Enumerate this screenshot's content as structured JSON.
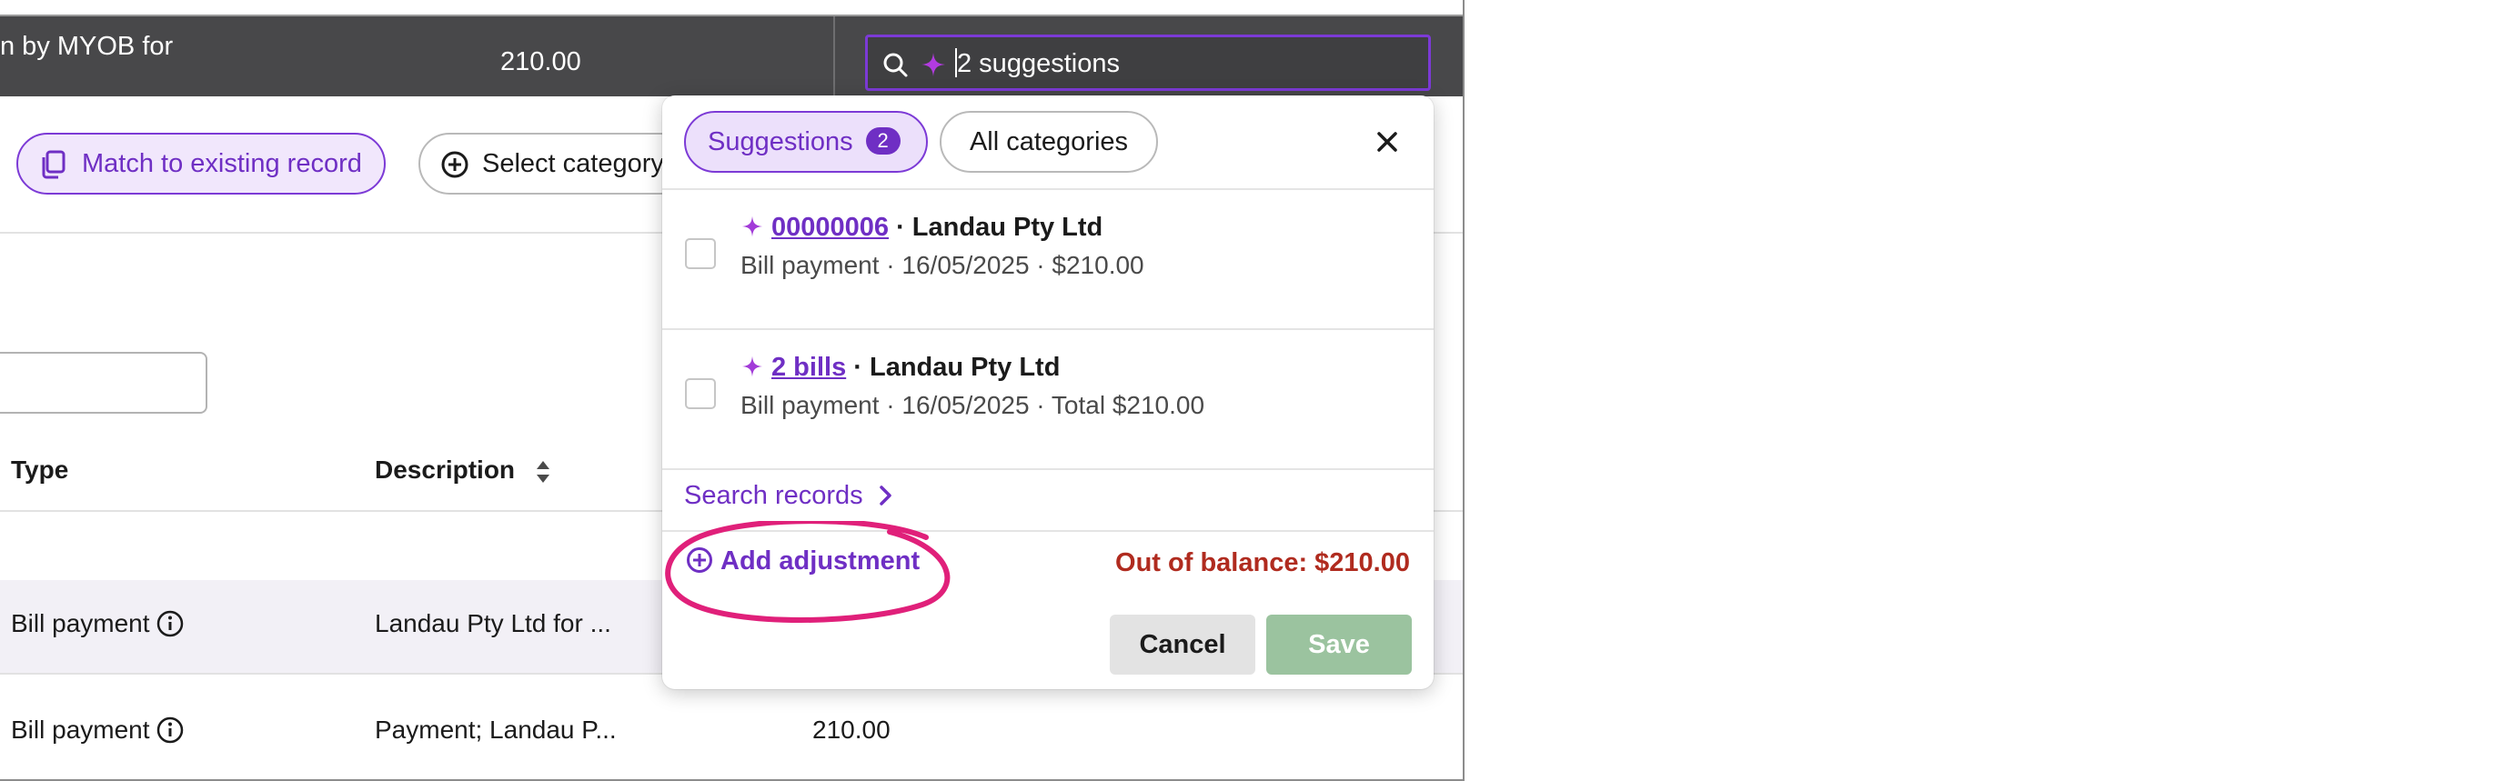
{
  "summary_bar": {
    "description": "n by MYOB for",
    "amount": "210.00",
    "search": {
      "value": "2 suggestions"
    }
  },
  "actions": {
    "match_label": "Match to existing record",
    "select_label": "Select category"
  },
  "table": {
    "headers": {
      "type": "Type",
      "description": "Description"
    },
    "rows": [
      {
        "type": "Bill payment",
        "description": "Landau Pty Ltd for ...",
        "amount": ""
      },
      {
        "type": "Bill payment",
        "description": "Payment; Landau P...",
        "amount": "210.00"
      }
    ]
  },
  "popover": {
    "tabs": {
      "suggestions_label": "Suggestions",
      "suggestions_count": "2",
      "all_label": "All categories"
    },
    "suggestions": [
      {
        "ref": "00000006",
        "party": "· Landau Pty Ltd",
        "details": "Bill payment · 16/05/2025 · $210.00"
      },
      {
        "ref": "2 bills",
        "party": "· Landau Pty Ltd",
        "details": "Bill payment · 16/05/2025 · Total $210.00"
      }
    ],
    "search_records_label": "Search records",
    "add_adjustment_label": "Add adjustment",
    "out_of_balance": "Out of balance: $210.00",
    "cancel_label": "Cancel",
    "save_label": "Save"
  },
  "colors": {
    "accent": "#7c3ad6",
    "accent_text": "#6f2fc4",
    "dark_bar": "#48484a",
    "error": "#b02b1f",
    "save_disabled": "#9bc39f",
    "annotation": "#e0207a"
  },
  "icons": [
    "search-icon",
    "sparkle-icon",
    "copy-icon",
    "plus-circle-icon",
    "sort-icon",
    "info-icon",
    "close-icon",
    "chevron-right-icon"
  ]
}
